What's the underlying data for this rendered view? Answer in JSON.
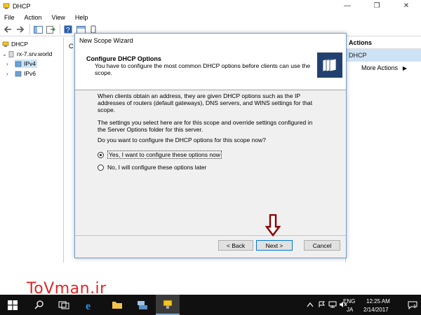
{
  "window": {
    "title": "DHCP",
    "controls": {
      "minimize": "—",
      "maximize": "❐",
      "close": "✕"
    }
  },
  "menu": [
    "File",
    "Action",
    "View",
    "Help"
  ],
  "tree": {
    "root": "DHCP",
    "server": "rx-7.srv.world",
    "ipv4": "IPv4",
    "ipv6": "IPv6"
  },
  "middle": {
    "label": "C"
  },
  "actions": {
    "header": "Actions",
    "section": "DHCP",
    "more": "More Actions",
    "more_arrow": "▶"
  },
  "wizard": {
    "title": "New Scope Wizard",
    "heading": "Configure DHCP Options",
    "subtext": "You have to configure the most common DHCP options before clients can use the scope.",
    "para1": "When clients obtain an address, they are given DHCP options such as the IP addresses of routers (default gateways), DNS servers, and WINS settings for that scope.",
    "para2": "The settings you select here are for this scope and override settings configured in the Server Options folder for this server.",
    "question": "Do you want to configure the DHCP options for this scope now?",
    "option_yes": "Yes, I want to configure these options now",
    "option_no": "No, I will configure these options later",
    "selected": "yes",
    "back_label": "< Back",
    "next_label": "Next >",
    "cancel_label": "Cancel"
  },
  "watermark": "ToVman.ir",
  "taskbar": {
    "lang_top": "ENG",
    "lang_bottom": "JA",
    "time": "12:25 AM",
    "date": "2/14/2017",
    "notification_count": "1"
  },
  "colors": {
    "accent": "#0078d7",
    "selection": "#cce4f7",
    "taskbar": "#101010",
    "arrow": "#8b0000",
    "watermark": "#e02626"
  }
}
